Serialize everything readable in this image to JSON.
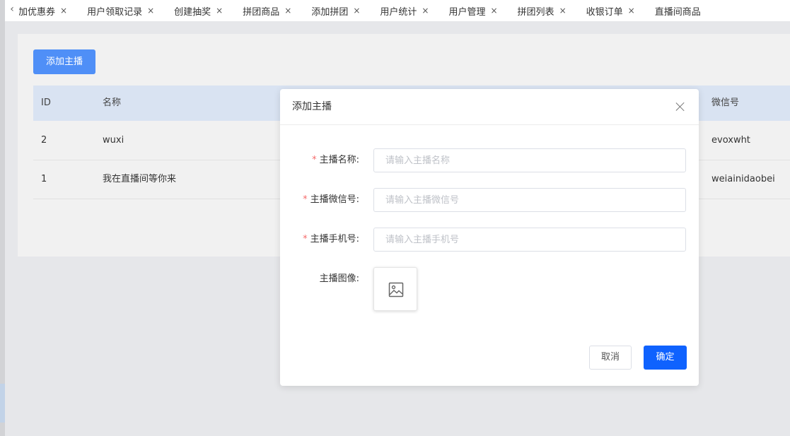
{
  "tabs": [
    {
      "label": "添加优惠券"
    },
    {
      "label": "用户领取记录"
    },
    {
      "label": "创建抽奖"
    },
    {
      "label": "拼团商品"
    },
    {
      "label": "添加拼团"
    },
    {
      "label": "用户统计"
    },
    {
      "label": "用户管理"
    },
    {
      "label": "拼团列表"
    },
    {
      "label": "收银订单"
    },
    {
      "label": "直播间商品"
    }
  ],
  "tab_close_glyph": "×",
  "tab_prev_glyph": "‹",
  "toolbar": {
    "add_label": "添加主播"
  },
  "table": {
    "columns": {
      "id": "ID",
      "name": "名称",
      "wechat": "微信号"
    },
    "rows": [
      {
        "id": "2",
        "name": "wuxi",
        "wechat": "evoxwht"
      },
      {
        "id": "1",
        "name": "我在直播间等你来",
        "wechat": "weiainidaobei"
      }
    ]
  },
  "modal": {
    "title": "添加主播",
    "fields": [
      {
        "label": "主播名称:",
        "required": true,
        "placeholder": "请输入主播名称",
        "value": ""
      },
      {
        "label": "主播微信号:",
        "required": true,
        "placeholder": "请输入主播微信号",
        "value": ""
      },
      {
        "label": "主播手机号:",
        "required": true,
        "placeholder": "请输入主播手机号",
        "value": ""
      }
    ],
    "image_label": "主播图像:",
    "image_icon": "image-icon",
    "cancel_label": "取消",
    "confirm_label": "确定",
    "required_mark": "*"
  },
  "colors": {
    "primary": "#0f62fe",
    "add_button": "#4f8ff7",
    "table_header": "#d9e3f2",
    "required": "#f56c6c"
  }
}
